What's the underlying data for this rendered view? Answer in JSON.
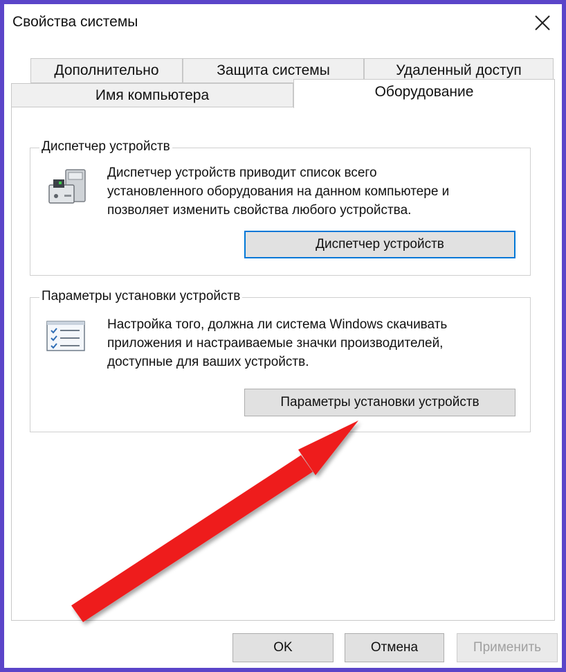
{
  "window": {
    "title": "Свойства системы",
    "close_icon": "close-icon"
  },
  "tabs": {
    "row_back": [
      "Дополнительно",
      "Защита системы",
      "Удаленный доступ"
    ],
    "row_front": [
      "Имя компьютера",
      "Оборудование"
    ],
    "active": "Оборудование"
  },
  "device_manager": {
    "group_title": "Диспетчер устройств",
    "description": [
      "Диспетчер устройств приводит список всего",
      "установленного оборудования на данном компьютере и",
      "позволяет изменить свойства любого устройства."
    ],
    "button_label": "Диспетчер устройств",
    "icon": "device-manager-icon"
  },
  "install_settings": {
    "group_title": "Параметры установки устройств",
    "description": [
      "Настройка того, должна ли система Windows скачивать",
      "приложения и настраиваемые значки производителей,",
      "доступные для ваших устройств."
    ],
    "button_label": "Параметры установки устройств",
    "icon": "checklist-icon"
  },
  "footer": {
    "ok_label": "OK",
    "cancel_label": "Отмена",
    "apply_label": "Применить"
  },
  "colors": {
    "frame": "#5b45c9",
    "focus": "#0078d7",
    "annotation_arrow": "#ee1c1c"
  }
}
